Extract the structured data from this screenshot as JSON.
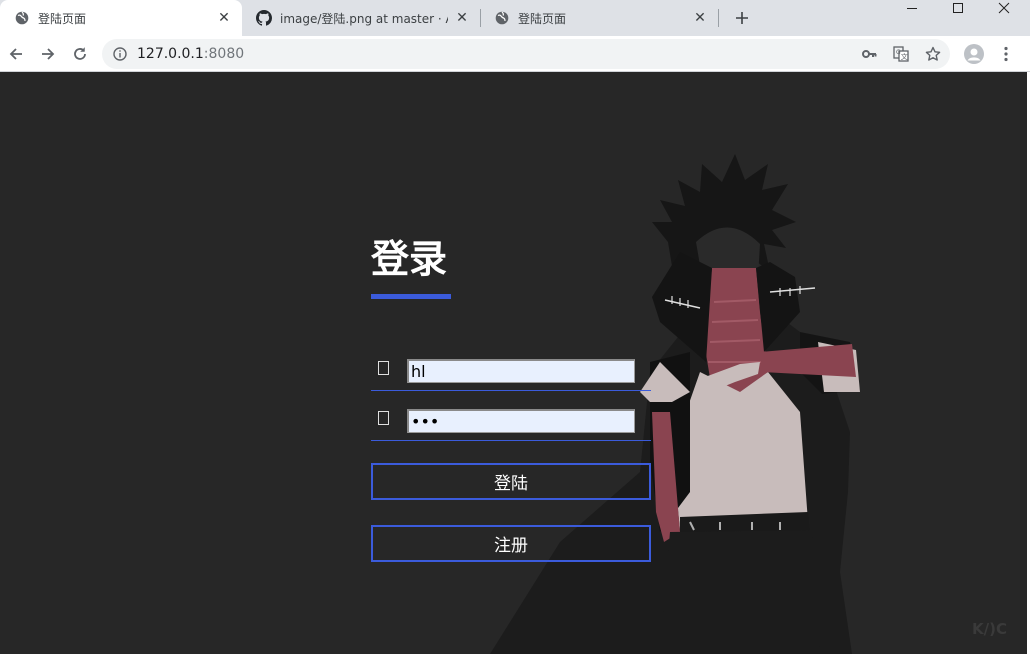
{
  "browser": {
    "tabs": [
      {
        "title": "登陆页面",
        "icon": "globe-icon",
        "active": true
      },
      {
        "title": "image/登陆.png at master · Alt",
        "icon": "github-icon",
        "active": false
      },
      {
        "title": "登陆页面",
        "icon": "globe-icon",
        "active": false
      }
    ],
    "address": {
      "host": "127.0.0.1",
      "port": ":8080"
    }
  },
  "login": {
    "title": "登录",
    "username_value": "hl",
    "password_value": "•••",
    "login_label": "登陆",
    "register_label": "注册"
  },
  "watermark": "K/)C",
  "colors": {
    "accent": "#3b5bdb",
    "background": "#272727",
    "input_bg": "#e8f0fe"
  }
}
